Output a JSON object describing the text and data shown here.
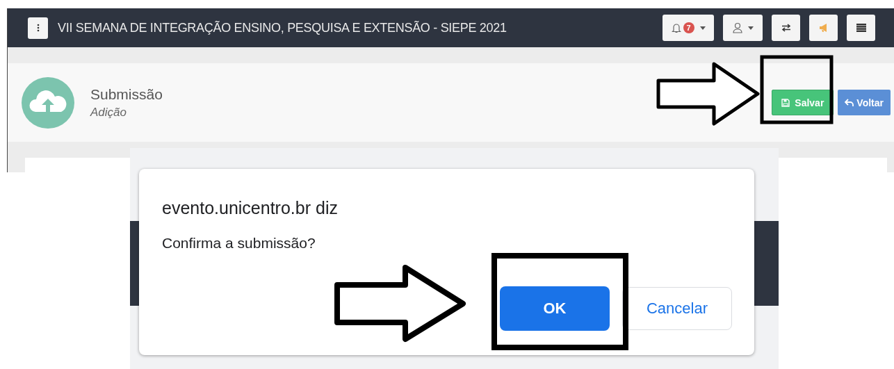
{
  "header": {
    "title": "VII SEMANA DE INTEGRAÇÃO ENSINO, PESQUISA E EXTENSÃO - SIEPE 2021",
    "notification_count": "7"
  },
  "page": {
    "title": "Submissão",
    "subtitle": "Adição"
  },
  "actions": [
    {
      "label": "Salvar",
      "kind": "save"
    },
    {
      "label": "Voltar",
      "kind": "back"
    }
  ],
  "dialog": {
    "title": "evento.unicentro.br diz",
    "message": "Confirma a submissão?",
    "buttons": [
      {
        "label": "OK",
        "kind": "primary"
      },
      {
        "label": "Cancelar",
        "kind": "secondary"
      }
    ]
  }
}
